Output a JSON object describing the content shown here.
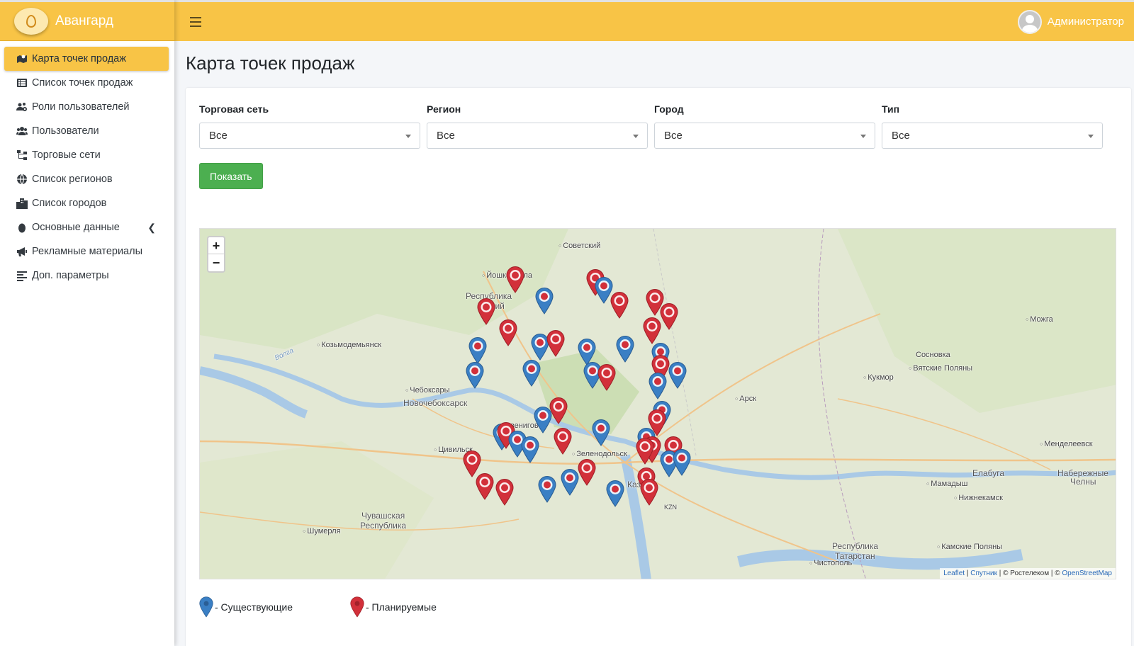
{
  "brand": {
    "name": "Авангард",
    "logo_icon": "avangard-logo-icon"
  },
  "header": {
    "user_name": "Администратор",
    "menu_icon": "hamburger-icon"
  },
  "sidebar": {
    "items": [
      {
        "label": "Карта точек продаж",
        "icon": "map-marked-icon",
        "active": true
      },
      {
        "label": "Список точек продаж",
        "icon": "list-icon"
      },
      {
        "label": "Роли пользователей",
        "icon": "users-cog-icon"
      },
      {
        "label": "Пользователи",
        "icon": "users-icon"
      },
      {
        "label": "Торговые сети",
        "icon": "sitemap-icon"
      },
      {
        "label": "Список регионов",
        "icon": "globe-icon"
      },
      {
        "label": "Список городов",
        "icon": "city-icon"
      },
      {
        "label": "Основные данные",
        "icon": "egg-icon",
        "has_submenu": true
      },
      {
        "label": "Рекламные материалы",
        "icon": "bullhorn-icon"
      },
      {
        "label": "Доп. параметры",
        "icon": "align-left-icon"
      }
    ]
  },
  "page": {
    "title": "Карта точек продаж"
  },
  "filters": [
    {
      "label": "Торговая сеть",
      "value": "Все"
    },
    {
      "label": "Регион",
      "value": "Все"
    },
    {
      "label": "Город",
      "value": "Все"
    },
    {
      "label": "Тип",
      "value": "Все"
    }
  ],
  "show_button": "Показать",
  "map": {
    "zoom_in": "+",
    "zoom_out": "−",
    "places": [
      "Советский",
      "Йошкар-Ола",
      "Республика",
      "Марий",
      "Козьмодемьянск",
      "Чебоксары",
      "Новочебоксарск",
      "Звенигово",
      "Цивильск",
      "Зеленодольск",
      "Казань",
      "KZN",
      "Чувашская",
      "Республика",
      "Шумерля",
      "Можга",
      "Сосновка",
      "Вятские Поляны",
      "Кукмор",
      "Арск",
      "Менделеевск",
      "Елабуга",
      "Набережные",
      "Челны",
      "Мамадыш",
      "Нижнекамск",
      "Камские Поляны",
      "Республика",
      "Татарстан",
      "Чистополь",
      "Волга"
    ],
    "attribution": {
      "leaflet": "Leaflet",
      "sputnik": "Спутник",
      "rostelecom": "© Ростелеком",
      "osm": "OpenStreetMap"
    },
    "existing_color": "#3a7fc4",
    "planned_color": "#d2303a"
  },
  "legend": {
    "existing": "- Существующие",
    "planned": "- Планируемые"
  }
}
